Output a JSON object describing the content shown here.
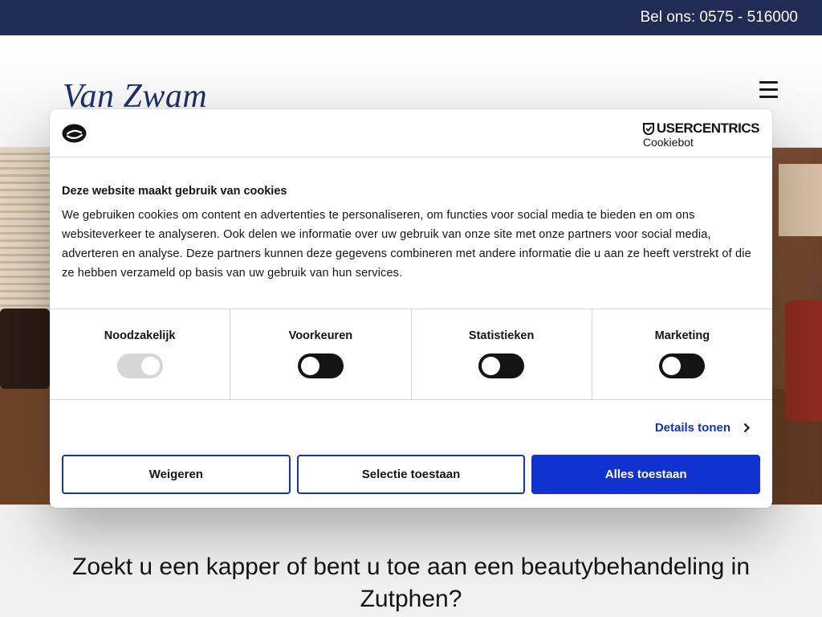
{
  "topbar": {
    "phone": "Bel ons: 0575 - 516000"
  },
  "header": {
    "logo": "Van Zwam",
    "menu_icon": "hamburger-icon"
  },
  "cookie_dialog": {
    "brand_line1": "USERCENTRICS",
    "brand_line2": "Cookiebot",
    "title": "Deze website maakt gebruik van cookies",
    "text": "We gebruiken cookies om content en advertenties te personaliseren, om functies voor social media te bieden en om ons websiteverkeer te analyseren. Ook delen we informatie over uw gebruik van onze site met onze partners voor social media, adverteren en analyse. Deze partners kunnen deze gegevens combineren met andere informatie die u aan ze heeft verstrekt of die ze hebben verzameld op basis van uw gebruik van hun services.",
    "toggles": [
      {
        "label": "Noodzakelijk",
        "checked": true,
        "disabled": true
      },
      {
        "label": "Voorkeuren",
        "checked": false,
        "disabled": false
      },
      {
        "label": "Statistieken",
        "checked": false,
        "disabled": false
      },
      {
        "label": "Marketing",
        "checked": false,
        "disabled": false
      }
    ],
    "details_label": "Details tonen",
    "buttons": {
      "decline": "Weigeren",
      "selection": "Selectie toestaan",
      "allow_all": "Alles toestaan"
    },
    "accent_color": "#1032cf"
  },
  "tagline": "Zoekt u een kapper of bent u toe aan een beautybehandeling in Zutphen?"
}
